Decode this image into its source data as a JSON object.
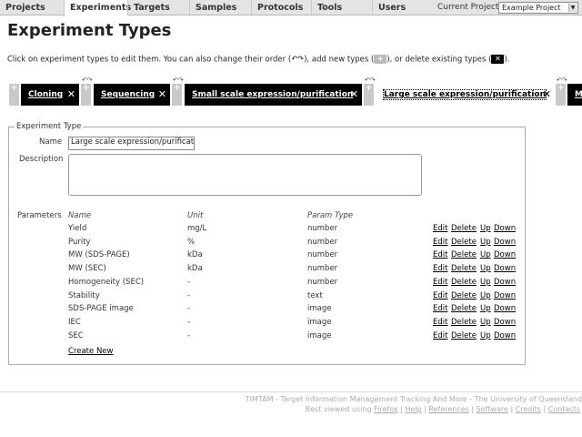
{
  "nav": {
    "tabs": [
      "Projects",
      "Experiments",
      "Targets",
      "Samples",
      "Protocols",
      "Tools",
      "Users"
    ],
    "current_project_label": "Current Project",
    "current_project_value": "Example Project"
  },
  "page_title": "Experiment Types",
  "intro": {
    "part1": "Click on experiment types to edit them. You can also change their order (",
    "part2": "), add new types (",
    "part3": "), or delete existing types (",
    "part4": ")."
  },
  "types": [
    "Cloning",
    "Sequencing",
    "Small scale expression/purification",
    "Large scale expression/purification",
    "M"
  ],
  "active_type": "Large scale expression/purification",
  "form": {
    "legend": "Experiment Type",
    "name_label": "Name",
    "name_value": "Large scale expression/purification",
    "description_label": "Description",
    "description_value": "",
    "parameters_label": "Parameters"
  },
  "parameters": {
    "headers": [
      "Name",
      "Unit",
      "Param Type"
    ],
    "actions": [
      "Edit",
      "Delete",
      "Up",
      "Down"
    ],
    "rows": [
      {
        "name": "Yield",
        "unit": "mg/L",
        "type": "number"
      },
      {
        "name": "Purity",
        "unit": "%",
        "type": "number"
      },
      {
        "name": "MW (SDS-PAGE)",
        "unit": "kDa",
        "type": "number"
      },
      {
        "name": "MW (SEC)",
        "unit": "kDa",
        "type": "number"
      },
      {
        "name": "Homogeneity (SEC)",
        "unit": "-",
        "type": "number"
      },
      {
        "name": "Stability",
        "unit": "-",
        "type": "text"
      },
      {
        "name": "SDS-PAGE image",
        "unit": "-",
        "type": "image"
      },
      {
        "name": "IEC",
        "unit": "-",
        "type": "image"
      },
      {
        "name": "SEC",
        "unit": "-",
        "type": "image"
      }
    ]
  },
  "create_new": "Create New",
  "footer": {
    "line1": "TIMTAM - Target Information Management Tracking And More - The University of Queensland",
    "line2_prefix": "Best viewed using",
    "links": [
      "Firefox",
      "Help",
      "References",
      "Software",
      "Credits",
      "Contacts"
    ]
  }
}
